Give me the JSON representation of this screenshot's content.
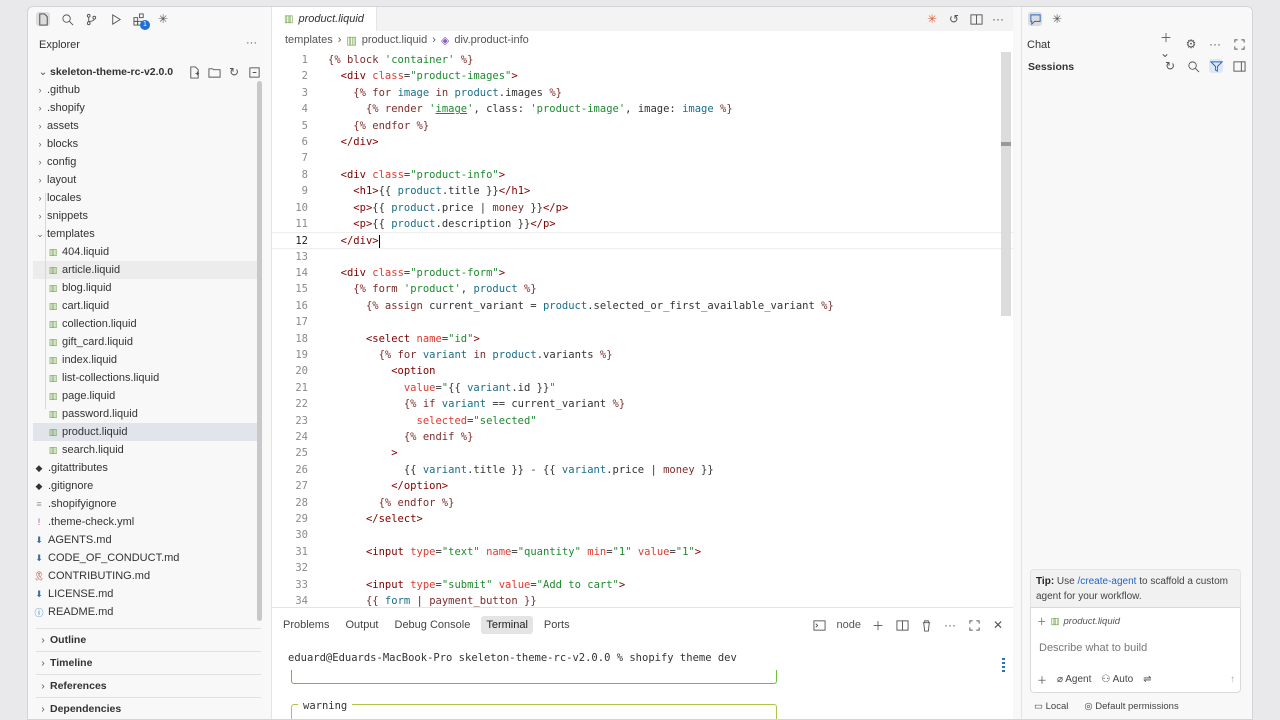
{
  "explorer": {
    "title": "Explorer",
    "more": "···",
    "root": "skeleton-theme-rc-v2.0.0",
    "badge_count": "1",
    "items": [
      {
        "label": ".github",
        "kind": "folder"
      },
      {
        "label": ".shopify",
        "kind": "folder"
      },
      {
        "label": "assets",
        "kind": "folder"
      },
      {
        "label": "blocks",
        "kind": "folder"
      },
      {
        "label": "config",
        "kind": "folder"
      },
      {
        "label": "layout",
        "kind": "folder"
      },
      {
        "label": "locales",
        "kind": "folder"
      },
      {
        "label": "snippets",
        "kind": "folder"
      },
      {
        "label": "templates",
        "kind": "folder-open"
      },
      {
        "label": "404.liquid",
        "kind": "liquid"
      },
      {
        "label": "article.liquid",
        "kind": "liquid"
      },
      {
        "label": "blog.liquid",
        "kind": "liquid"
      },
      {
        "label": "cart.liquid",
        "kind": "liquid"
      },
      {
        "label": "collection.liquid",
        "kind": "liquid"
      },
      {
        "label": "gift_card.liquid",
        "kind": "liquid"
      },
      {
        "label": "index.liquid",
        "kind": "liquid"
      },
      {
        "label": "list-collections.liquid",
        "kind": "liquid"
      },
      {
        "label": "page.liquid",
        "kind": "liquid"
      },
      {
        "label": "password.liquid",
        "kind": "liquid"
      },
      {
        "label": "product.liquid",
        "kind": "liquid"
      },
      {
        "label": "search.liquid",
        "kind": "liquid"
      },
      {
        "label": ".gitattributes",
        "kind": "git"
      },
      {
        "label": ".gitignore",
        "kind": "git"
      },
      {
        "label": ".shopifyignore",
        "kind": "ignore"
      },
      {
        "label": ".theme-check.yml",
        "kind": "yml"
      },
      {
        "label": "AGENTS.md",
        "kind": "md"
      },
      {
        "label": "CODE_OF_CONDUCT.md",
        "kind": "md"
      },
      {
        "label": "CONTRIBUTING.md",
        "kind": "md-ribbon"
      },
      {
        "label": "LICENSE.md",
        "kind": "md"
      },
      {
        "label": "README.md",
        "kind": "info"
      }
    ],
    "sections": [
      "Outline",
      "Timeline",
      "References",
      "Dependencies"
    ]
  },
  "editor": {
    "tab": "product.liquid",
    "breadcrumb": [
      "templates",
      "product.liquid",
      "div.product-info"
    ],
    "current_line": 12
  },
  "panel": {
    "tabs": [
      "Problems",
      "Output",
      "Debug Console",
      "Terminal",
      "Ports"
    ],
    "active_tab": "Terminal",
    "terminal_name": "node",
    "prompt_line": "eduard@Eduards-MacBook-Pro skeleton-theme-rc-v2.0.0 % shopify theme dev",
    "warning_label": "warning"
  },
  "chat": {
    "title": "Chat",
    "sessions": "Sessions",
    "tip_prefix": "Tip:",
    "tip_use": " Use ",
    "tip_link": "/create-agent",
    "tip_suffix": " to scaffold a custom agent for your workflow.",
    "context_file": "product.liquid",
    "placeholder": "Describe what to build",
    "mode": "Agent",
    "model": "Auto",
    "footer_local": "Local",
    "footer_permissions": "Default permissions"
  },
  "colors": {
    "liquid_icon": "#6ba042",
    "link": "#2266c4",
    "terminal_box": "#6bbf3b"
  }
}
